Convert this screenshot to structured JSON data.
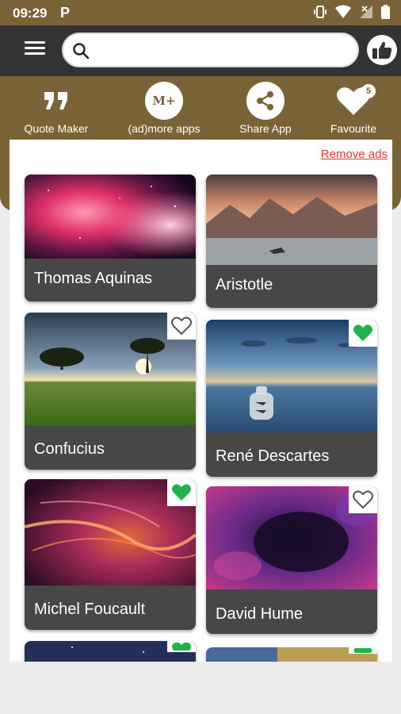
{
  "status_bar": {
    "time": "09:29",
    "notification_icon": "P"
  },
  "search": {
    "placeholder": "",
    "value": ""
  },
  "actions": [
    {
      "label": "Quote Maker",
      "icon": "quote-icon"
    },
    {
      "label": "(ad)more apps",
      "icon": "m-plus-icon",
      "icon_text": "M+"
    },
    {
      "label": "Share App",
      "icon": "share-icon"
    },
    {
      "label": "Favourite",
      "icon": "heart-icon",
      "badge": "5"
    }
  ],
  "remove_ads": "Remove ads",
  "cards": [
    {
      "name": "Thomas Aquinas",
      "favourite": null
    },
    {
      "name": "Aristotle",
      "favourite": null
    },
    {
      "name": "Confucius",
      "favourite": false
    },
    {
      "name": "René Descartes",
      "favourite": true
    },
    {
      "name": "Michel Foucault",
      "favourite": true
    },
    {
      "name": "David Hume",
      "favourite": false
    }
  ],
  "colors": {
    "brand": "#7a6336",
    "top_bar": "#333333",
    "card": "#474747",
    "favourite_on": "#22b14c",
    "remove_ads": "#e53935"
  }
}
